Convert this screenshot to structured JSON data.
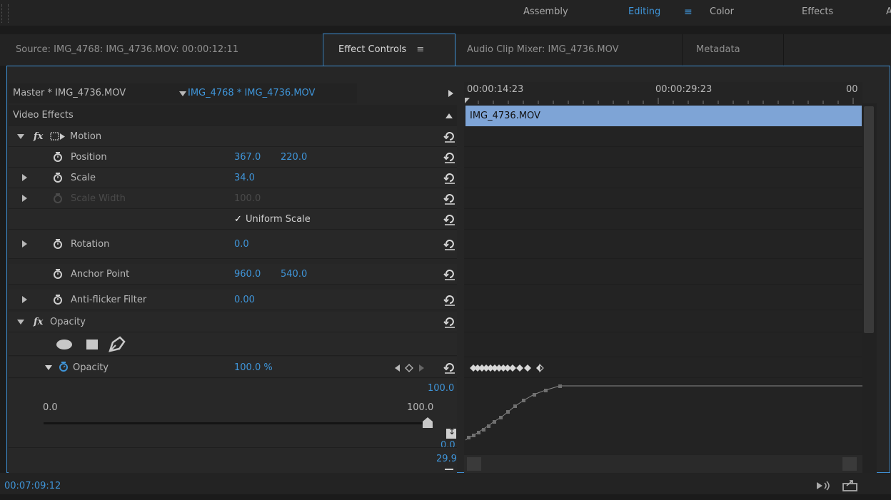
{
  "workspaces": {
    "items": [
      "Assembly",
      "Editing",
      "Color",
      "Effects",
      "A"
    ],
    "active": "Editing"
  },
  "tabs": {
    "source": "Source: IMG_4768: IMG_4736.MOV: 00:00:12:11",
    "effect_controls": "Effect Controls",
    "audio_mixer": "Audio Clip Mixer: IMG_4736.MOV",
    "metadata": "Metadata"
  },
  "header": {
    "master": "Master * IMG_4736.MOV",
    "sequence_clip": "IMG_4768 * IMG_4736.MOV"
  },
  "section": {
    "video_effects": "Video Effects"
  },
  "motion": {
    "label": "Motion",
    "position": {
      "label": "Position",
      "x": "367.0",
      "y": "220.0"
    },
    "scale": {
      "label": "Scale",
      "value": "34.0"
    },
    "scale_width": {
      "label": "Scale Width",
      "value": "100.0"
    },
    "uniform_scale": {
      "label": "Uniform Scale",
      "checked": true
    },
    "rotation": {
      "label": "Rotation",
      "value": "0.0"
    },
    "anchor": {
      "label": "Anchor Point",
      "x": "960.0",
      "y": "540.0"
    },
    "antiflicker": {
      "label": "Anti-flicker Filter",
      "value": "0.00"
    }
  },
  "opacity": {
    "label": "Opacity",
    "param_label": "Opacity",
    "value": "100.0 %",
    "graph_max": "100.0",
    "graph_min": "0.0",
    "slider_min": "0.0",
    "slider_max": "100.0",
    "rate": "29.9",
    "slider_level": 1.0
  },
  "timeline": {
    "tc1": "00:00:14:23",
    "tc2": "00:00:29:23",
    "tc3": "00",
    "clip_name": "IMG_4736.MOV"
  },
  "footer": {
    "timecode": "00:07:09:12"
  },
  "colors": {
    "accent": "#3f95d9",
    "clip": "#7ea4d6",
    "bg": "#262626"
  },
  "icons": [
    "fx-icon",
    "stopwatch-icon",
    "reset-icon",
    "ellipse-mask-icon",
    "rect-mask-icon",
    "pen-mask-icon",
    "keyframe-prev-icon",
    "keyframe-add-icon",
    "keyframe-next-icon",
    "play-audio-icon",
    "export-icon"
  ]
}
